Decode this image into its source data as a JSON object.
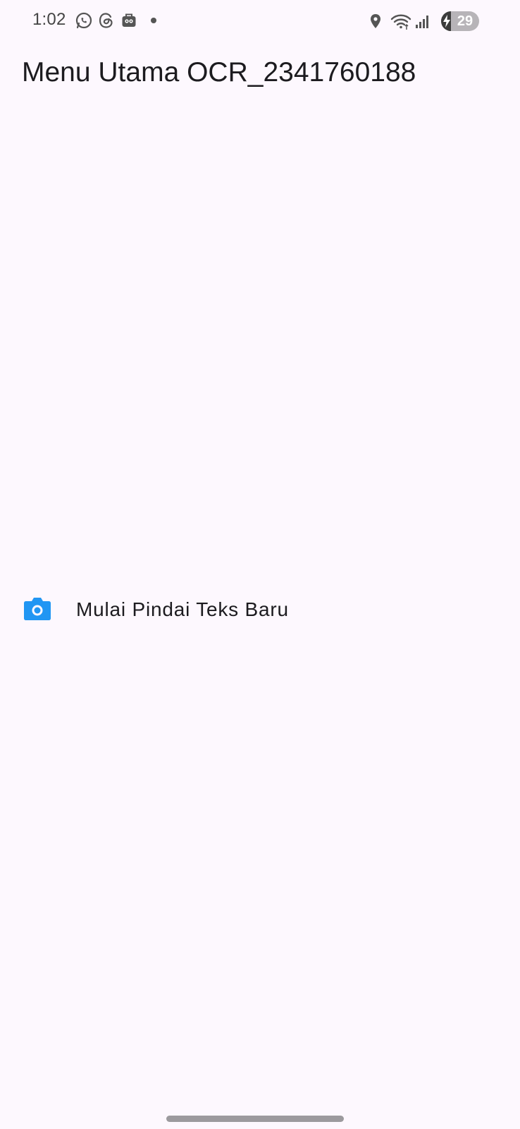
{
  "status_bar": {
    "time": "1:02",
    "left_icons": [
      "whatsapp-icon",
      "threads-icon",
      "app-notification-icon",
      "more-notifications-dot"
    ],
    "right_icons": [
      "location-icon",
      "wifi-icon",
      "signal-icon"
    ],
    "battery_level": "29",
    "battery_charging": true
  },
  "app_bar": {
    "title": "Menu Utama OCR_2341760188"
  },
  "menu": {
    "items": [
      {
        "icon": "camera-icon",
        "label": "Mulai Pindai Teks Baru",
        "icon_color": "#2196f3"
      }
    ]
  },
  "colors": {
    "background": "#fdf8fe",
    "text": "#1c1b1f",
    "accent": "#2196f3"
  }
}
